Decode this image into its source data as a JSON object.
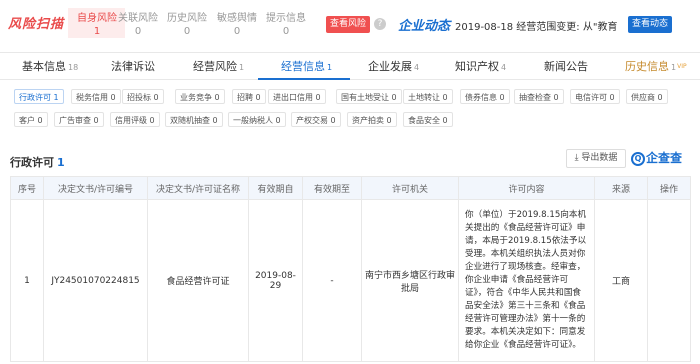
{
  "risk_bar": {
    "logo": "风险扫描",
    "items": [
      {
        "label": "自身风险",
        "count": "1",
        "hot": true
      },
      {
        "label": "关联风险",
        "count": "0",
        "hot": false
      },
      {
        "label": "历史风险",
        "count": "0",
        "hot": false
      },
      {
        "label": "敏感舆情",
        "count": "0",
        "hot": false
      },
      {
        "label": "提示信息",
        "count": "0",
        "hot": false
      }
    ],
    "view_risk_button": "查看风险",
    "help_icon": "?"
  },
  "news": {
    "title": "企业动态",
    "text": "2019-08-18 经营范围变更: 从\"教育信...",
    "view_button": "查看动态"
  },
  "tabs": [
    {
      "label": "基本信息",
      "count": "18"
    },
    {
      "label": "法律诉讼",
      "count": ""
    },
    {
      "label": "经营风险",
      "count": "1"
    },
    {
      "label": "经营信息",
      "count": "1"
    },
    {
      "label": "企业发展",
      "count": "4"
    },
    {
      "label": "知识产权",
      "count": "4"
    },
    {
      "label": "新闻公告",
      "count": ""
    },
    {
      "label": "历史信息",
      "count": "1",
      "badge": "VIP"
    }
  ],
  "chips_row1": [
    {
      "label": "行政许可",
      "count": "1"
    },
    {
      "label": "税务信用",
      "count": "0"
    },
    {
      "label": "招投标",
      "count": "0"
    },
    {
      "label": "业务竞争",
      "count": "0"
    },
    {
      "label": "招聘",
      "count": "0"
    },
    {
      "label": "进出口信用",
      "count": "0"
    },
    {
      "label": "国有土地受让",
      "count": "0"
    },
    {
      "label": "土地转让",
      "count": "0"
    },
    {
      "label": "债券信息",
      "count": "0"
    },
    {
      "label": "抽查检查",
      "count": "0"
    },
    {
      "label": "电信许可",
      "count": "0"
    },
    {
      "label": "供应商",
      "count": "0"
    }
  ],
  "chips_row2": [
    {
      "label": "客户",
      "count": "0"
    },
    {
      "label": "广告审查",
      "count": "0"
    },
    {
      "label": "信用评级",
      "count": "0"
    },
    {
      "label": "双随机抽查",
      "count": "0"
    },
    {
      "label": "一般纳税人",
      "count": "0"
    },
    {
      "label": "产权交易",
      "count": "0"
    },
    {
      "label": "资产拍卖",
      "count": "0"
    },
    {
      "label": "食品安全",
      "count": "0"
    }
  ],
  "section": {
    "title": "行政许可",
    "count": "1",
    "export_button": "导出数据",
    "brand": "企查查"
  },
  "table": {
    "headers": [
      "序号",
      "决定文书/许可编号",
      "决定文书/许可证名称",
      "有效期自",
      "有效期至",
      "许可机关",
      "许可内容",
      "来源",
      "操作"
    ],
    "rows": [
      {
        "index": "1",
        "number": "JY24501070224815",
        "name": "食品经营许可证",
        "valid_from": "2019-08-29",
        "valid_to": "-",
        "authority": "南宁市西乡塘区行政审批局",
        "content": "你（单位）于2019.8.15向本机关提出的《食品经营许可证》申请，本局于2019.8.15依法予以受理。本机关组织执法人员对你企业进行了现场核查。经审查，你企业申请《食品经营许可证》，符合《中华人民共和国食品安全法》第三十三条和《食品经营许可管理办法》第十一条的要求。本机关决定如下：同意发给你企业《食品经营许可证》。",
        "source": "工商",
        "action": ""
      }
    ]
  }
}
